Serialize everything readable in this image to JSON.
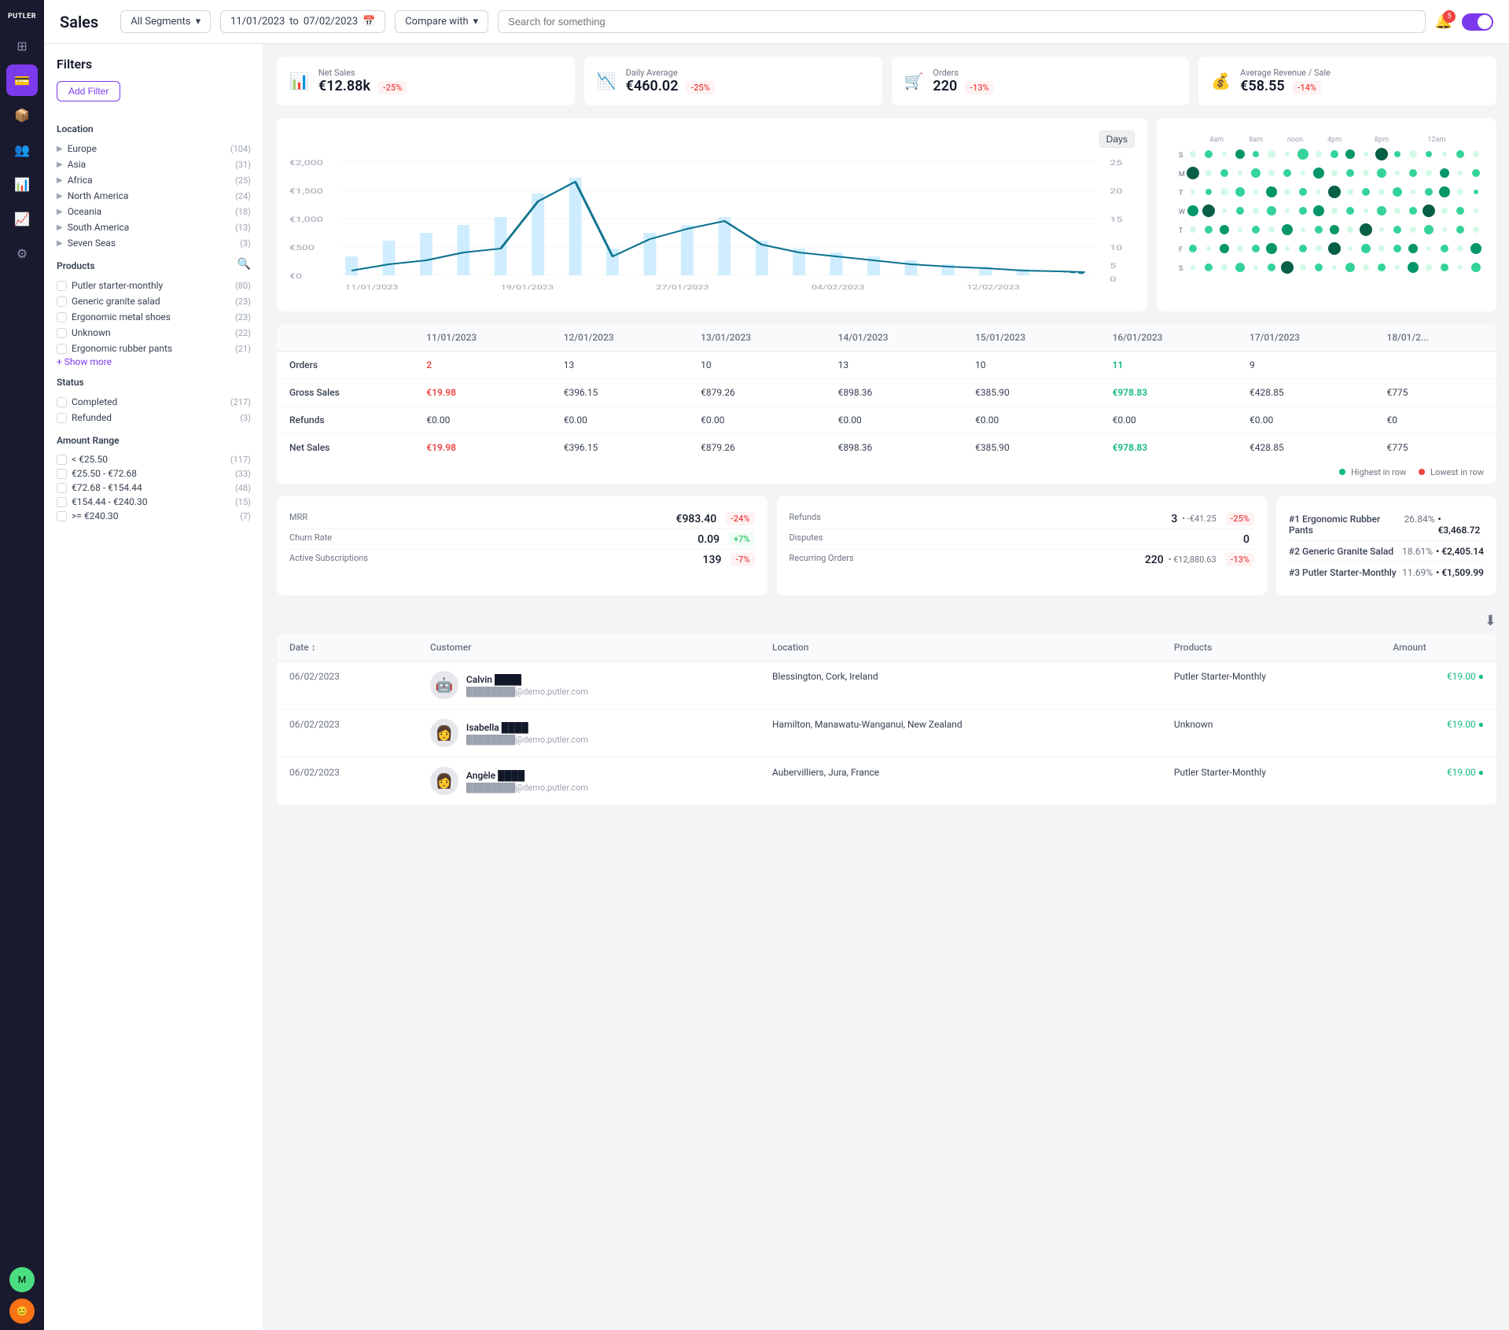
{
  "app": {
    "name": "PUTLER"
  },
  "header": {
    "title": "Sales",
    "segment_label": "All Segments",
    "date_from": "11/01/2023",
    "date_to": "07/02/2023",
    "compare_label": "Compare with",
    "search_placeholder": "Search for something",
    "bell_count": "5"
  },
  "kpis": [
    {
      "id": "net-sales",
      "label": "Net Sales",
      "value": "€12.88k",
      "badge": "-25%",
      "badge_type": "red"
    },
    {
      "id": "daily-average",
      "label": "Daily Average",
      "value": "€460.02",
      "badge": "-25%",
      "badge_type": "red"
    },
    {
      "id": "orders",
      "label": "Orders",
      "value": "220",
      "badge": "-13%",
      "badge_type": "red"
    },
    {
      "id": "avg-revenue",
      "label": "Average Revenue / Sale",
      "value": "€58.55",
      "badge": "-14%",
      "badge_type": "red"
    }
  ],
  "chart": {
    "days_label": "Days",
    "x_labels": [
      "11/01/2023",
      "19/01/2023",
      "27/01/2023",
      "04/02/2023",
      "12/02/2023"
    ],
    "y_left": [
      "€2,000",
      "€1,500",
      "€1,000",
      "€500",
      "€0"
    ],
    "y_right": [
      "25",
      "20",
      "15",
      "10",
      "5",
      "0"
    ]
  },
  "dot_chart": {
    "x_labels": [
      "4am",
      "8am",
      "noon",
      "4pm",
      "8pm",
      "12am"
    ],
    "y_labels": [
      "S",
      "M",
      "T",
      "W",
      "T",
      "F",
      "S"
    ]
  },
  "sales_table": {
    "columns": [
      "",
      "11/01/2023",
      "12/01/2023",
      "13/01/2023",
      "14/01/2023",
      "15/01/2023",
      "16/01/2023",
      "17/01/2023",
      "18/01/2..."
    ],
    "rows": [
      {
        "label": "Orders",
        "values": [
          "2",
          "13",
          "10",
          "13",
          "10",
          "11",
          "9",
          ""
        ]
      },
      {
        "label": "Gross Sales",
        "values": [
          "€19.98",
          "€396.15",
          "€879.26",
          "€898.36",
          "€385.90",
          "€978.83",
          "€428.85",
          "€775"
        ]
      },
      {
        "label": "Refunds",
        "values": [
          "€0.00",
          "€0.00",
          "€0.00",
          "€0.00",
          "€0.00",
          "€0.00",
          "€0.00",
          "€0"
        ]
      },
      {
        "label": "Net Sales",
        "values": [
          "€19.98",
          "€396.15",
          "€879.26",
          "€898.36",
          "€385.90",
          "€978.83",
          "€428.85",
          "€775"
        ]
      }
    ]
  },
  "legend": {
    "highest": "Highest in row",
    "lowest": "Lowest in row"
  },
  "metrics_left": {
    "items": [
      {
        "label": "MRR",
        "value": "€983.40",
        "badge": "-24%",
        "badge_type": "red"
      },
      {
        "label": "Churn Rate",
        "value": "0.09",
        "badge": "+7%",
        "badge_type": "green"
      },
      {
        "label": "Active Subscriptions",
        "value": "139",
        "badge": "-7%",
        "badge_type": "red"
      }
    ]
  },
  "metrics_mid": {
    "items": [
      {
        "label": "Refunds",
        "value": "3",
        "sub": "•  -€41.25",
        "badge": "-25%",
        "badge_type": "red"
      },
      {
        "label": "Disputes",
        "value": "0",
        "sub": ""
      },
      {
        "label": "Recurring Orders",
        "value": "220",
        "sub": "• €12,880.63",
        "badge": "-13%",
        "badge_type": "red"
      }
    ]
  },
  "top_products": {
    "items": [
      {
        "rank": "#1 Ergonomic Rubber Pants",
        "pct": "26.84%",
        "value": "•  €3,468.72"
      },
      {
        "rank": "#2 Generic Granite Salad",
        "pct": "18.61%",
        "value": "•  €2,405.14"
      },
      {
        "rank": "#3 Putler Starter-Monthly",
        "pct": "11.69%",
        "value": "•  €1,509.99"
      }
    ]
  },
  "customer_table": {
    "columns": [
      "Date",
      "Customer",
      "Location",
      "Products",
      "Amount"
    ],
    "rows": [
      {
        "date": "06/02/2023",
        "name": "Calvin ████",
        "email": "████████@demo.putler.com",
        "location": "Blessington, Cork, Ireland",
        "product": "Putler Starter-Monthly",
        "amount": "€19.00",
        "avatar": "🤖"
      },
      {
        "date": "06/02/2023",
        "name": "Isabella ████",
        "email": "████████@demo.putler.com",
        "location": "Hamilton, Manawatu-Wanganui, New Zealand",
        "product": "Unknown",
        "amount": "€19.00",
        "avatar": "👩"
      },
      {
        "date": "06/02/2023",
        "name": "Angèle ████",
        "email": "████████@demo.putler.com",
        "location": "Aubervilliers, Jura, France",
        "product": "Putler Starter-Monthly",
        "amount": "€19.00",
        "avatar": "👩"
      }
    ]
  },
  "filters": {
    "title": "Filters",
    "add_filter": "Add Filter",
    "location": {
      "title": "Location",
      "items": [
        {
          "label": "Europe",
          "count": "(104)"
        },
        {
          "label": "Asia",
          "count": "(31)"
        },
        {
          "label": "Africa",
          "count": "(25)"
        },
        {
          "label": "North America",
          "count": "(24)"
        },
        {
          "label": "Oceania",
          "count": "(18)"
        },
        {
          "label": "South America",
          "count": "(13)"
        },
        {
          "label": "Seven Seas",
          "count": "(3)"
        }
      ]
    },
    "products": {
      "title": "Products",
      "items": [
        {
          "label": "Putler starter-monthly",
          "count": "(80)"
        },
        {
          "label": "Generic granite salad",
          "count": "(23)"
        },
        {
          "label": "Ergonomic metal shoes",
          "count": "(23)"
        },
        {
          "label": "Unknown",
          "count": "(22)"
        },
        {
          "label": "Ergonomic rubber pants",
          "count": "(21)"
        }
      ],
      "show_more": "+ Show more"
    },
    "status": {
      "title": "Status",
      "items": [
        {
          "label": "Completed",
          "count": "(217)"
        },
        {
          "label": "Refunded",
          "count": "(3)"
        }
      ]
    },
    "amount_range": {
      "title": "Amount Range",
      "items": [
        {
          "label": "< €25.50",
          "count": "(117)"
        },
        {
          "label": "€25.50 - €72.68",
          "count": "(33)"
        },
        {
          "label": "€72.68 - €154.44",
          "count": "(48)"
        },
        {
          "label": "€154.44 - €240.30",
          "count": "(15)"
        },
        {
          "label": ">= €240.30",
          "count": "(7)"
        }
      ]
    }
  }
}
